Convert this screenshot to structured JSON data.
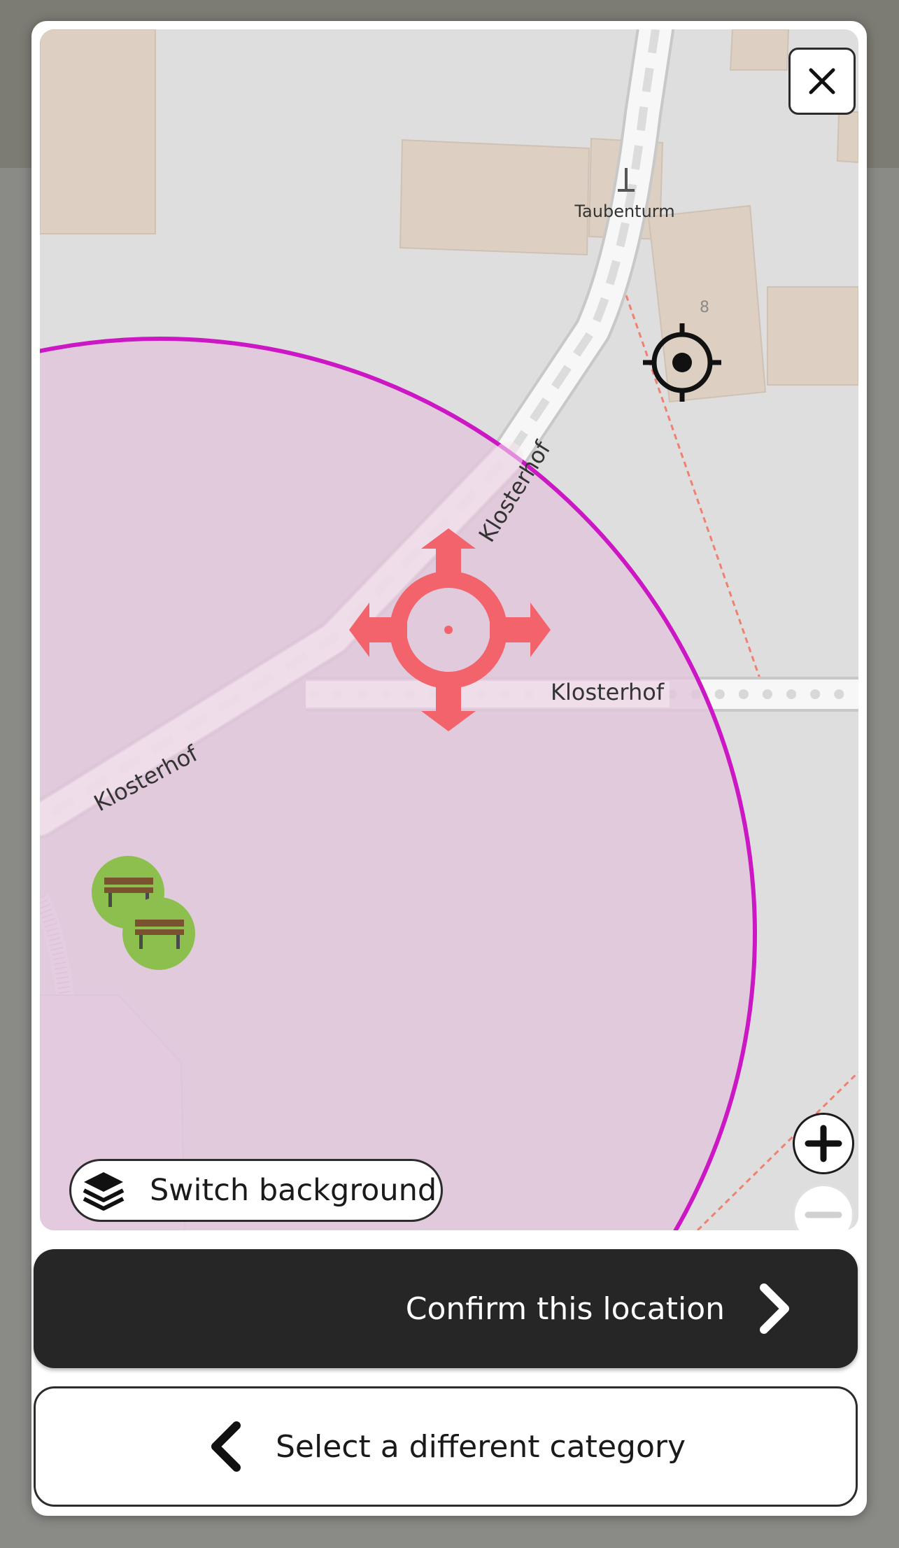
{
  "map": {
    "poi_label": "Taubenturm",
    "house_number": "8",
    "street_labels": [
      "Klosterhof",
      "Klosterhof",
      "Klosterhof"
    ],
    "icons": [
      "location-marker-icon",
      "user-location-icon",
      "bench-icon",
      "bench-icon",
      "tower-icon"
    ],
    "colors": {
      "area_fill": "#e2c6dc",
      "area_border": "#cc18c4",
      "marker": "#f2636b",
      "building": "#ddd0c3",
      "road": "#f7f7f7",
      "path": "#f08070",
      "bench_circle": "#8cbf4e"
    }
  },
  "controls": {
    "switch_background_label": "Switch background",
    "zoom_in_icon": "plus-icon",
    "zoom_out_icon": "minus-icon",
    "close_icon": "close-icon"
  },
  "actions": {
    "confirm_label": "Confirm this location",
    "back_label": "Select a different category"
  }
}
